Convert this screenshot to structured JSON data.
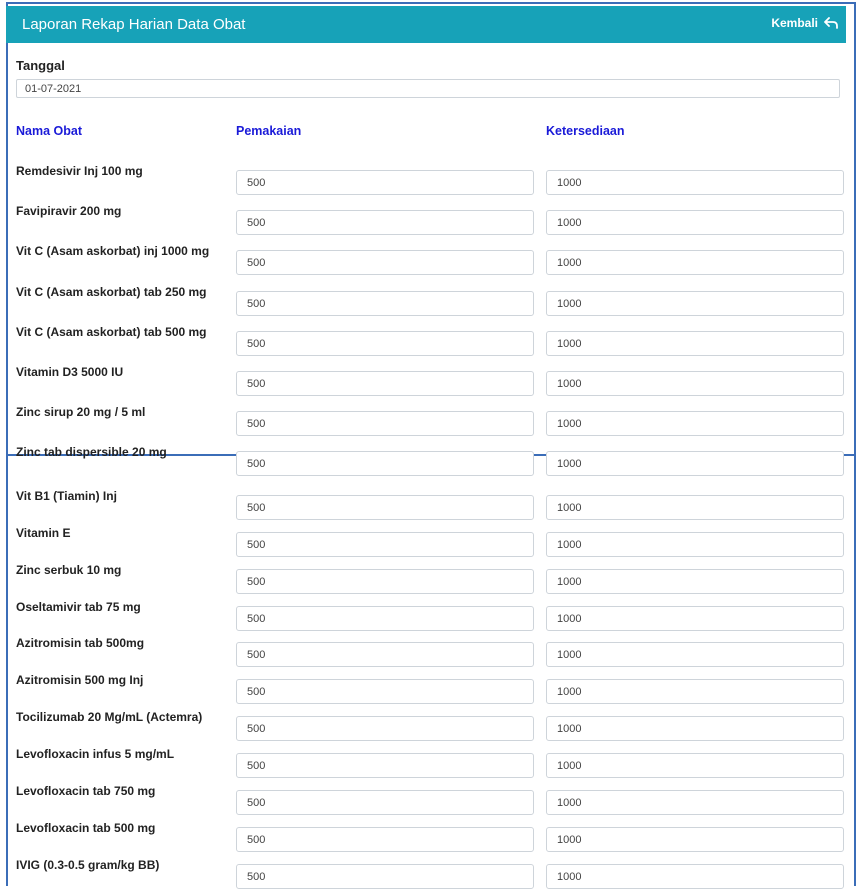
{
  "header": {
    "title": "Laporan Rekap Harian Data Obat",
    "back_label": "Kembali"
  },
  "date": {
    "label": "Tanggal",
    "value": "01-07-2021"
  },
  "columns": {
    "name": "Nama Obat",
    "usage": "Pemakaian",
    "stock": "Ketersediaan"
  },
  "rows_top": [
    {
      "name": "Remdesivir Inj 100 mg",
      "usage": "500",
      "stock": "1000"
    },
    {
      "name": "Favipiravir 200 mg",
      "usage": "500",
      "stock": "1000"
    },
    {
      "name": "Vit C (Asam askorbat) inj 1000 mg",
      "usage": "500",
      "stock": "1000"
    },
    {
      "name": "Vit C (Asam askorbat) tab 250 mg",
      "usage": "500",
      "stock": "1000"
    },
    {
      "name": "Vit C (Asam askorbat) tab 500 mg",
      "usage": "500",
      "stock": "1000"
    },
    {
      "name": "Vitamin D3 5000 IU",
      "usage": "500",
      "stock": "1000"
    },
    {
      "name": "Zinc sirup 20 mg / 5 ml",
      "usage": "500",
      "stock": "1000"
    },
    {
      "name": "Zinc tab dispersible 20 mg",
      "usage": "500",
      "stock": "1000"
    }
  ],
  "rows_bottom": [
    {
      "name": "Vit B1 (Tiamin) Inj",
      "usage": "500",
      "stock": "1000"
    },
    {
      "name": "Vitamin E",
      "usage": "500",
      "stock": "1000"
    },
    {
      "name": "Zinc serbuk 10 mg",
      "usage": "500",
      "stock": "1000"
    },
    {
      "name": "Oseltamivir tab 75 mg",
      "usage": "500",
      "stock": "1000"
    },
    {
      "name": "Azitromisin tab 500mg",
      "usage": "500",
      "stock": "1000"
    },
    {
      "name": "Azitromisin 500 mg Inj",
      "usage": "500",
      "stock": "1000"
    },
    {
      "name": "Tocilizumab 20 Mg/mL (Actemra)",
      "usage": "500",
      "stock": "1000"
    },
    {
      "name": "Levofloxacin infus 5 mg/mL",
      "usage": "500",
      "stock": "1000"
    },
    {
      "name": "Levofloxacin tab 750 mg",
      "usage": "500",
      "stock": "1000"
    },
    {
      "name": "Levofloxacin tab 500 mg",
      "usage": "500",
      "stock": "1000"
    },
    {
      "name": "IVIG (0.3-0.5 gram/kg BB)",
      "usage": "500",
      "stock": "1000"
    }
  ],
  "colors": {
    "header_bg": "#17a2b8",
    "column_header": "#1a1ad8",
    "panel_border": "#3b6db8"
  },
  "icons": {
    "back": "reply-arrow-icon"
  }
}
